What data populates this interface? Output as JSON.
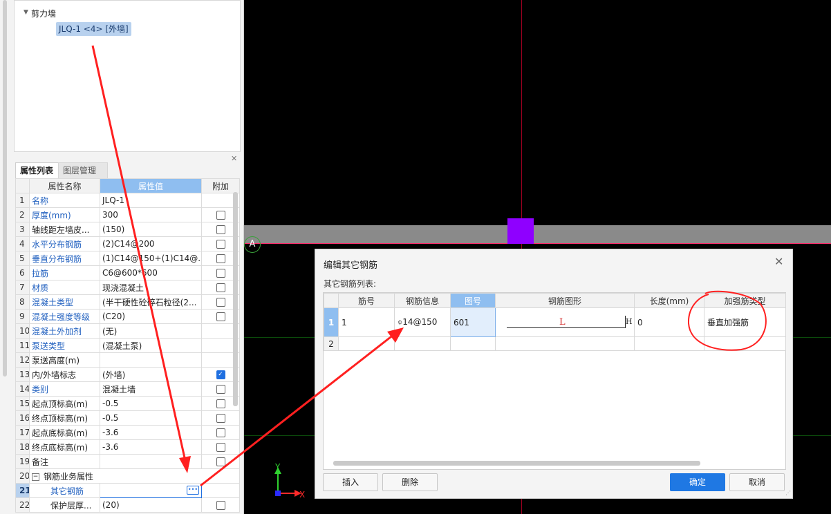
{
  "tree": {
    "root": "剪力墙",
    "selected": "JLQ-1 <4> [外墙]"
  },
  "panel": {
    "tabs": [
      "属性列表",
      "图层管理"
    ],
    "headers": [
      "属性名称",
      "属性值",
      "附加"
    ],
    "rows": [
      {
        "n": "1",
        "name": "名称",
        "value": "JLQ-1",
        "blue": true,
        "check": "none"
      },
      {
        "n": "2",
        "name": "厚度(mm)",
        "value": "300",
        "blue": true,
        "check": "off"
      },
      {
        "n": "3",
        "name": "轴线距左墙皮...",
        "value": "(150)",
        "blue": false,
        "check": "off"
      },
      {
        "n": "4",
        "name": "水平分布钢筋",
        "value": "(2)C14@200",
        "blue": true,
        "check": "off"
      },
      {
        "n": "5",
        "name": "垂直分布钢筋",
        "value": "(1)C14@150+(1)C14@...",
        "blue": true,
        "check": "off"
      },
      {
        "n": "6",
        "name": "拉筋",
        "value": "C6@600*600",
        "blue": true,
        "check": "off"
      },
      {
        "n": "7",
        "name": "材质",
        "value": "现浇混凝土",
        "blue": true,
        "check": "off"
      },
      {
        "n": "8",
        "name": "混凝土类型",
        "value": "(半干硬性砼碎石粒径(2...",
        "blue": true,
        "check": "off"
      },
      {
        "n": "9",
        "name": "混凝土强度等级",
        "value": "(C20)",
        "blue": true,
        "check": "off"
      },
      {
        "n": "10",
        "name": "混凝土外加剂",
        "value": "(无)",
        "blue": true,
        "check": "none"
      },
      {
        "n": "11",
        "name": "泵送类型",
        "value": "(混凝土泵)",
        "blue": true,
        "check": "none"
      },
      {
        "n": "12",
        "name": "泵送高度(m)",
        "value": "",
        "blue": false,
        "check": "none"
      },
      {
        "n": "13",
        "name": "内/外墙标志",
        "value": "(外墙)",
        "blue": false,
        "check": "on"
      },
      {
        "n": "14",
        "name": "类别",
        "value": "混凝土墙",
        "blue": true,
        "check": "off"
      },
      {
        "n": "15",
        "name": "起点顶标高(m)",
        "value": "-0.5",
        "blue": false,
        "check": "off"
      },
      {
        "n": "16",
        "name": "终点顶标高(m)",
        "value": "-0.5",
        "blue": false,
        "check": "off"
      },
      {
        "n": "17",
        "name": "起点底标高(m)",
        "value": "-3.6",
        "blue": false,
        "check": "off"
      },
      {
        "n": "18",
        "name": "终点底标高(m)",
        "value": "-3.6",
        "blue": false,
        "check": "off"
      },
      {
        "n": "19",
        "name": "备注",
        "value": "",
        "blue": false,
        "check": "off"
      },
      {
        "n": "20",
        "name": "钢筋业务属性",
        "value": "",
        "blue": false,
        "check": "none",
        "group": true
      },
      {
        "n": "21",
        "name": "其它钢筋",
        "value": "",
        "blue": true,
        "check": "none",
        "editing": true
      },
      {
        "n": "22",
        "name": "保护层厚...",
        "value": "(20)",
        "blue": false,
        "check": "off"
      }
    ]
  },
  "canvas": {
    "axis_label": "A",
    "x_label": "X",
    "y_label": "Y"
  },
  "dialog": {
    "title": "编辑其它钢筋",
    "subtitle": "其它钢筋列表:",
    "headers": [
      "筋号",
      "钢筋信息",
      "图号",
      "钢筋图形",
      "长度(mm)",
      "加强筋类型"
    ],
    "rows": [
      {
        "n": "1",
        "jinhao": "1",
        "info": "⌽14@150",
        "tuhao": "601",
        "shape_L": "L",
        "shape_H": "H",
        "length": "0",
        "type": "垂直加强筋"
      },
      {
        "n": "2",
        "jinhao": "",
        "info": "",
        "tuhao": "",
        "shape_L": "",
        "shape_H": "",
        "length": "",
        "type": ""
      }
    ],
    "buttons": {
      "insert": "插入",
      "delete": "删除",
      "ok": "确定",
      "cancel": "取消"
    }
  }
}
